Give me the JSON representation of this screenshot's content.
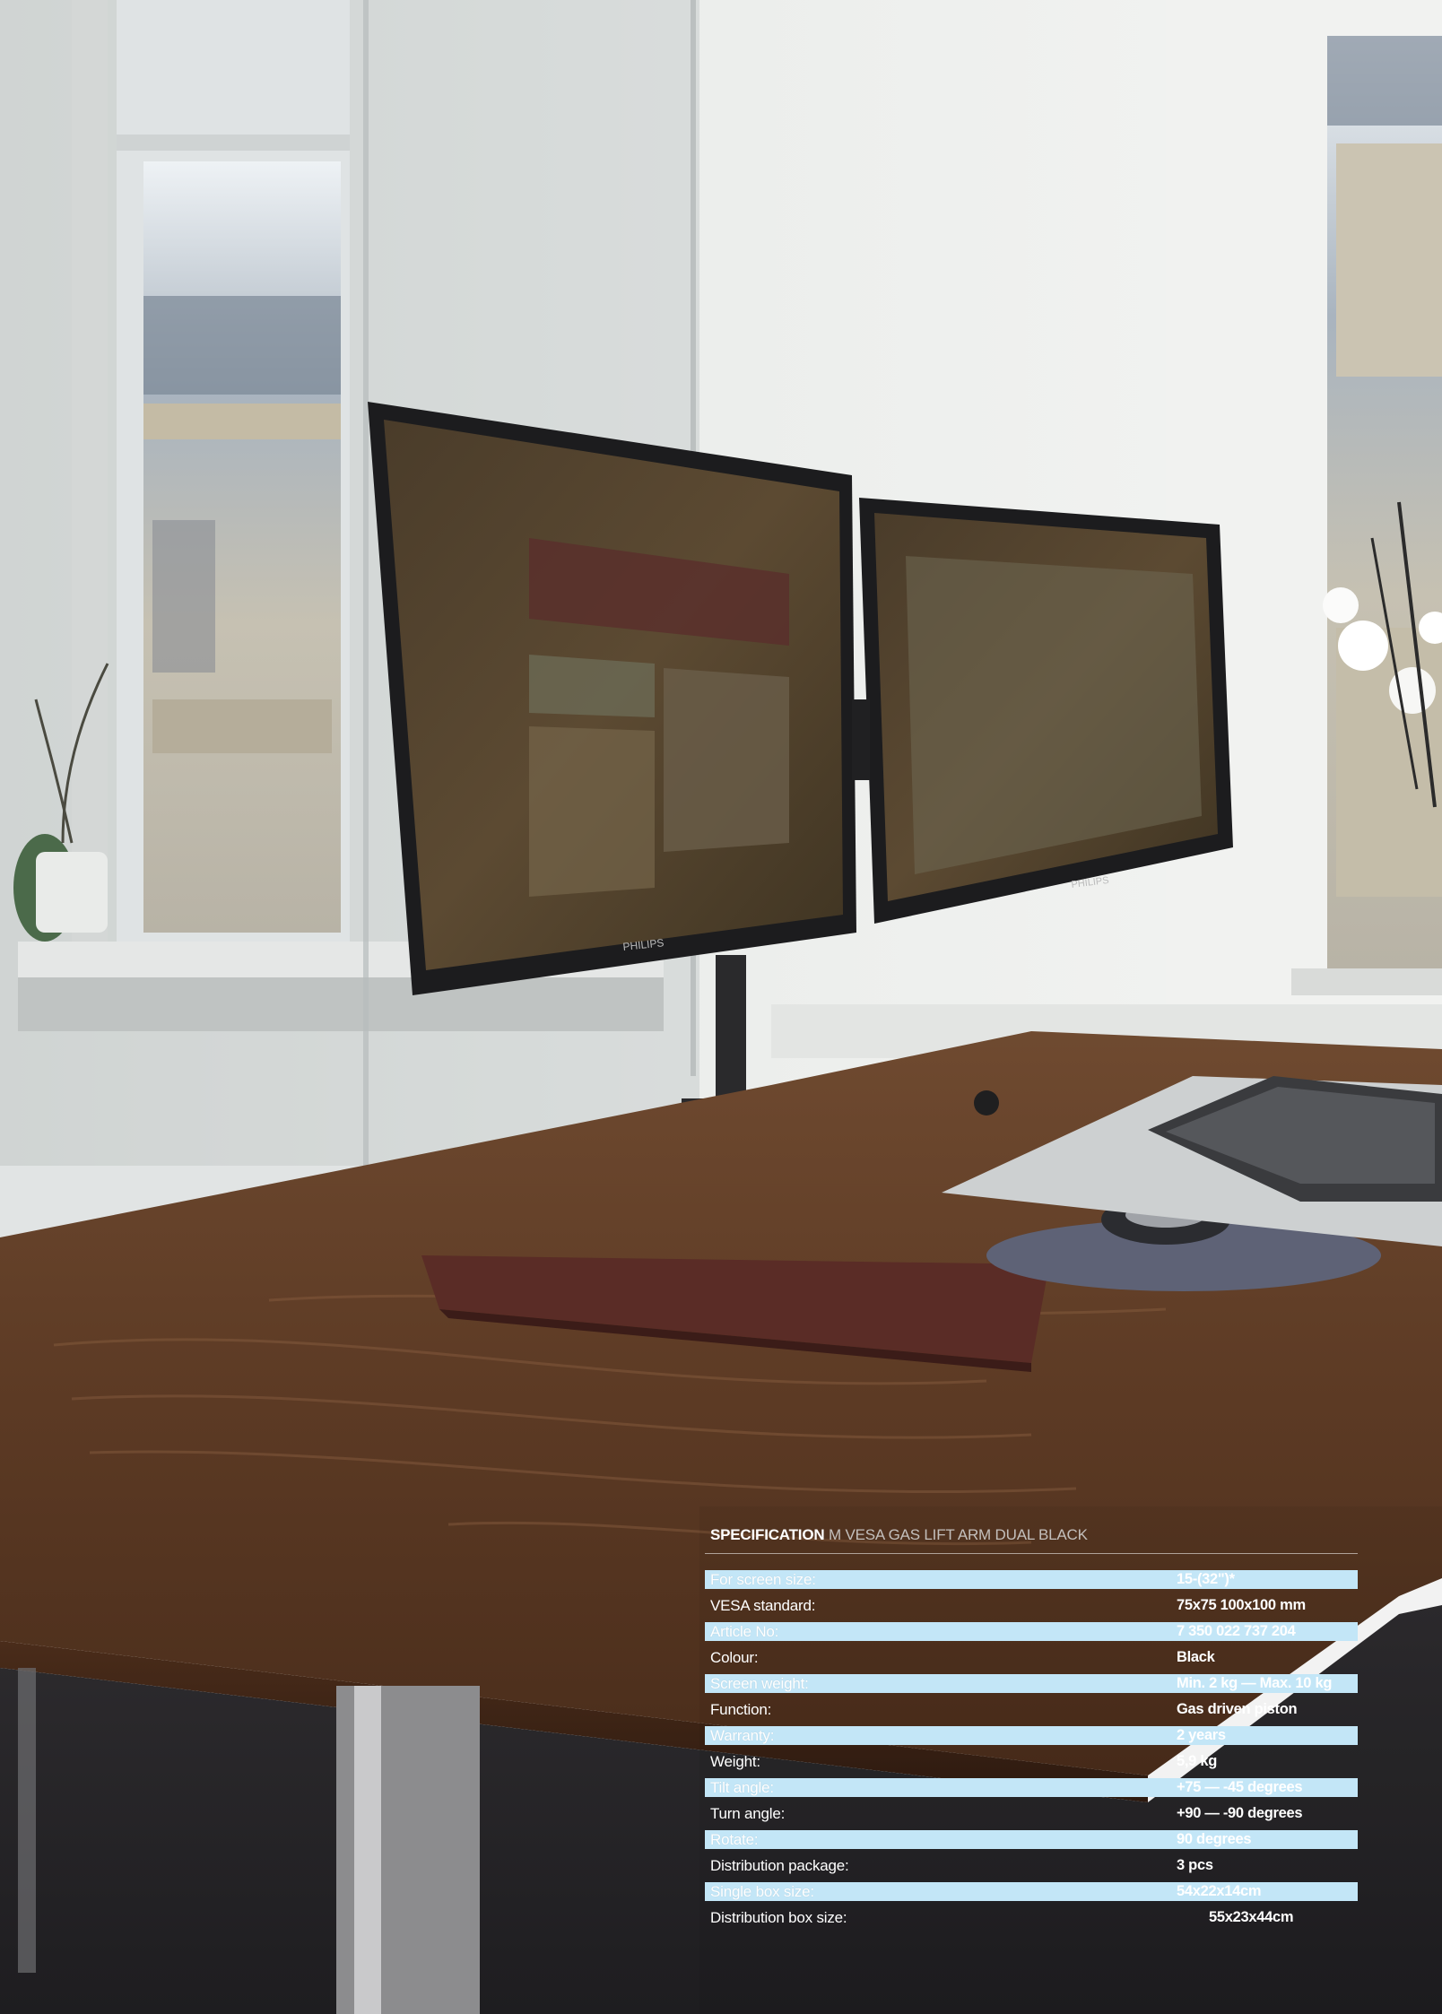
{
  "spec": {
    "title": "SPECIFICATION",
    "subtitle": "M VESA GAS LIFT ARM DUAL BLACK",
    "rows": [
      {
        "label": "For screen size:",
        "value": "15-(32\")*"
      },
      {
        "label": "VESA standard:",
        "value": "75x75 100x100 mm"
      },
      {
        "label": "Article No:",
        "value": "7 350 022 737 204"
      },
      {
        "label": "Colour:",
        "value": "Black"
      },
      {
        "label": "Screen weight:",
        "value": "Min. 2 kg — Max. 10 kg"
      },
      {
        "label": "Function:",
        "value": "Gas driven piston"
      },
      {
        "label": "Warranty:",
        "value": "2 years"
      },
      {
        "label": "Weight:",
        "value": "5,9 kg"
      },
      {
        "label": "Tilt angle:",
        "value": "+75 — -45 degrees"
      },
      {
        "label": "Turn angle:",
        "value": "+90 — -90 degrees"
      },
      {
        "label": "Rotate:",
        "value": "90 degrees"
      },
      {
        "label": "Distribution package:",
        "value": "3 pcs"
      },
      {
        "label": "Single box size:",
        "value": "54x22x14cm"
      },
      {
        "label": "Distribution box size:",
        "value": "55x23x44cm"
      }
    ]
  },
  "photo": {
    "monitor_brand": "PHILIPS"
  },
  "colors": {
    "band": "#c3e6f7",
    "desk": "#5e3a22",
    "wall": "#eef0ee"
  }
}
